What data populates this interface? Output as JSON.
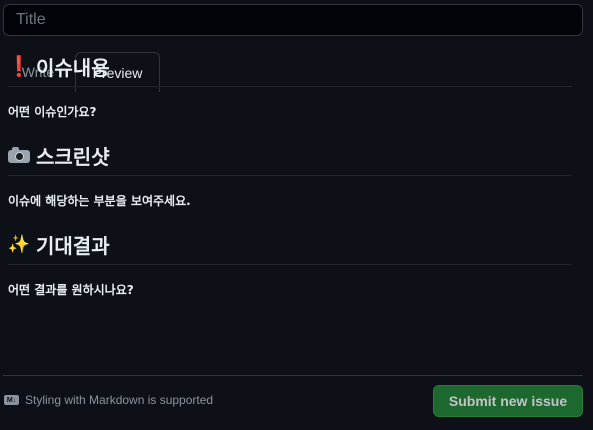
{
  "title_field": {
    "placeholder": "Title",
    "value": ""
  },
  "tabs": [
    {
      "label": "Write",
      "active": false
    },
    {
      "label": "Preview",
      "active": true
    }
  ],
  "preview": {
    "sections": [
      {
        "icon": "exclamation-icon",
        "emoji": "❗",
        "heading": "이슈내용",
        "body": "어떤 이슈인가요?"
      },
      {
        "icon": "camera-icon",
        "emoji": "📷",
        "heading": "스크린샷",
        "body": "이슈에 해당하는 부분을 보여주세요."
      },
      {
        "icon": "sparkles-icon",
        "emoji": "✨",
        "heading": "기대결과",
        "body": "어떤 결과를 원하시나요?"
      }
    ]
  },
  "footer": {
    "markdown_icon": "markdown-icon",
    "markdown_note": "Styling with Markdown is supported",
    "submit_label": "Submit new issue"
  },
  "colors": {
    "background": "#0d1117",
    "border": "#30363d",
    "text": "#e6edf3",
    "muted": "#8b949e",
    "submit": "#238636"
  }
}
